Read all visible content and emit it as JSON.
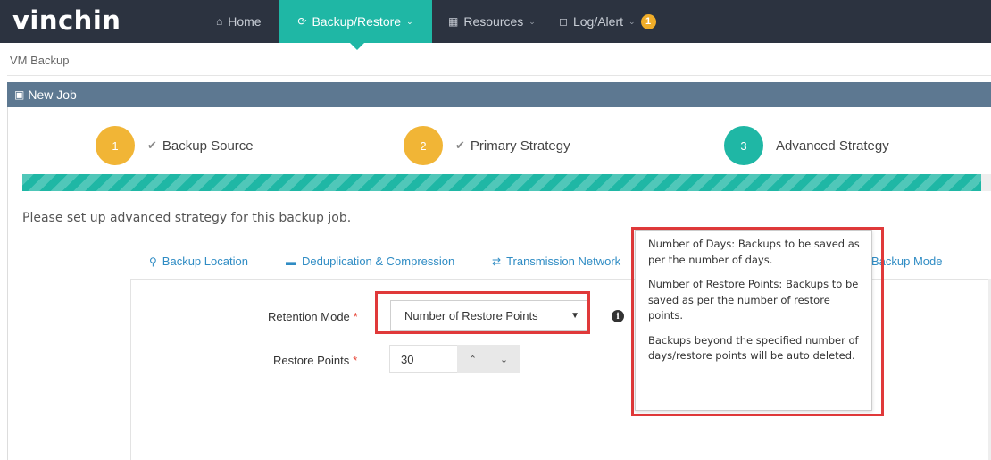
{
  "header": {
    "logo": "vinchin",
    "nav": [
      {
        "label": "Home",
        "icon": "home-icon"
      },
      {
        "label": "Backup/Restore",
        "icon": "refresh-icon",
        "active": true
      },
      {
        "label": "Resources",
        "icon": "grid-icon"
      },
      {
        "label": "Log/Alert",
        "icon": "bell-icon",
        "badge": "1"
      }
    ]
  },
  "breadcrumb": "VM Backup",
  "panel": {
    "title": "New Job",
    "icon": "briefcase-icon"
  },
  "wizard": {
    "steps": [
      {
        "number": "1",
        "label": "Backup Source",
        "status": "done"
      },
      {
        "number": "2",
        "label": "Primary Strategy",
        "status": "done"
      },
      {
        "number": "3",
        "label": "Advanced Strategy",
        "status": "active"
      }
    ],
    "progress_fraction": 0.99
  },
  "instruction": "Please set up advanced strategy for this backup job.",
  "subtabs": [
    {
      "label": "Backup Location",
      "icon": "map-pin-icon"
    },
    {
      "label": "Deduplication & Compression",
      "icon": "hdd-icon"
    },
    {
      "label": "Transmission Network",
      "icon": "exchange-icon"
    },
    {
      "label": "Backup Mode",
      "icon": ""
    }
  ],
  "form": {
    "retention_label": "Retention Mode",
    "retention_value": "Number of Restore Points",
    "restore_points_label": "Restore Points",
    "restore_points_value": "30",
    "required_mark": "*"
  },
  "tooltip": {
    "lines": [
      "Number of Days: Backups to be saved as per the number of days.",
      "Number of Restore Points: Backups to be saved as per the number of restore points.",
      "Backups beyond the specified number of days/restore points will be auto deleted."
    ]
  },
  "colors": {
    "topbar": "#2c3340",
    "accent": "#1fb7a5",
    "step_done": "#f1b536",
    "panel_header": "#5d7891",
    "highlight_frame": "#e0393a",
    "link": "#2f8cc4"
  }
}
